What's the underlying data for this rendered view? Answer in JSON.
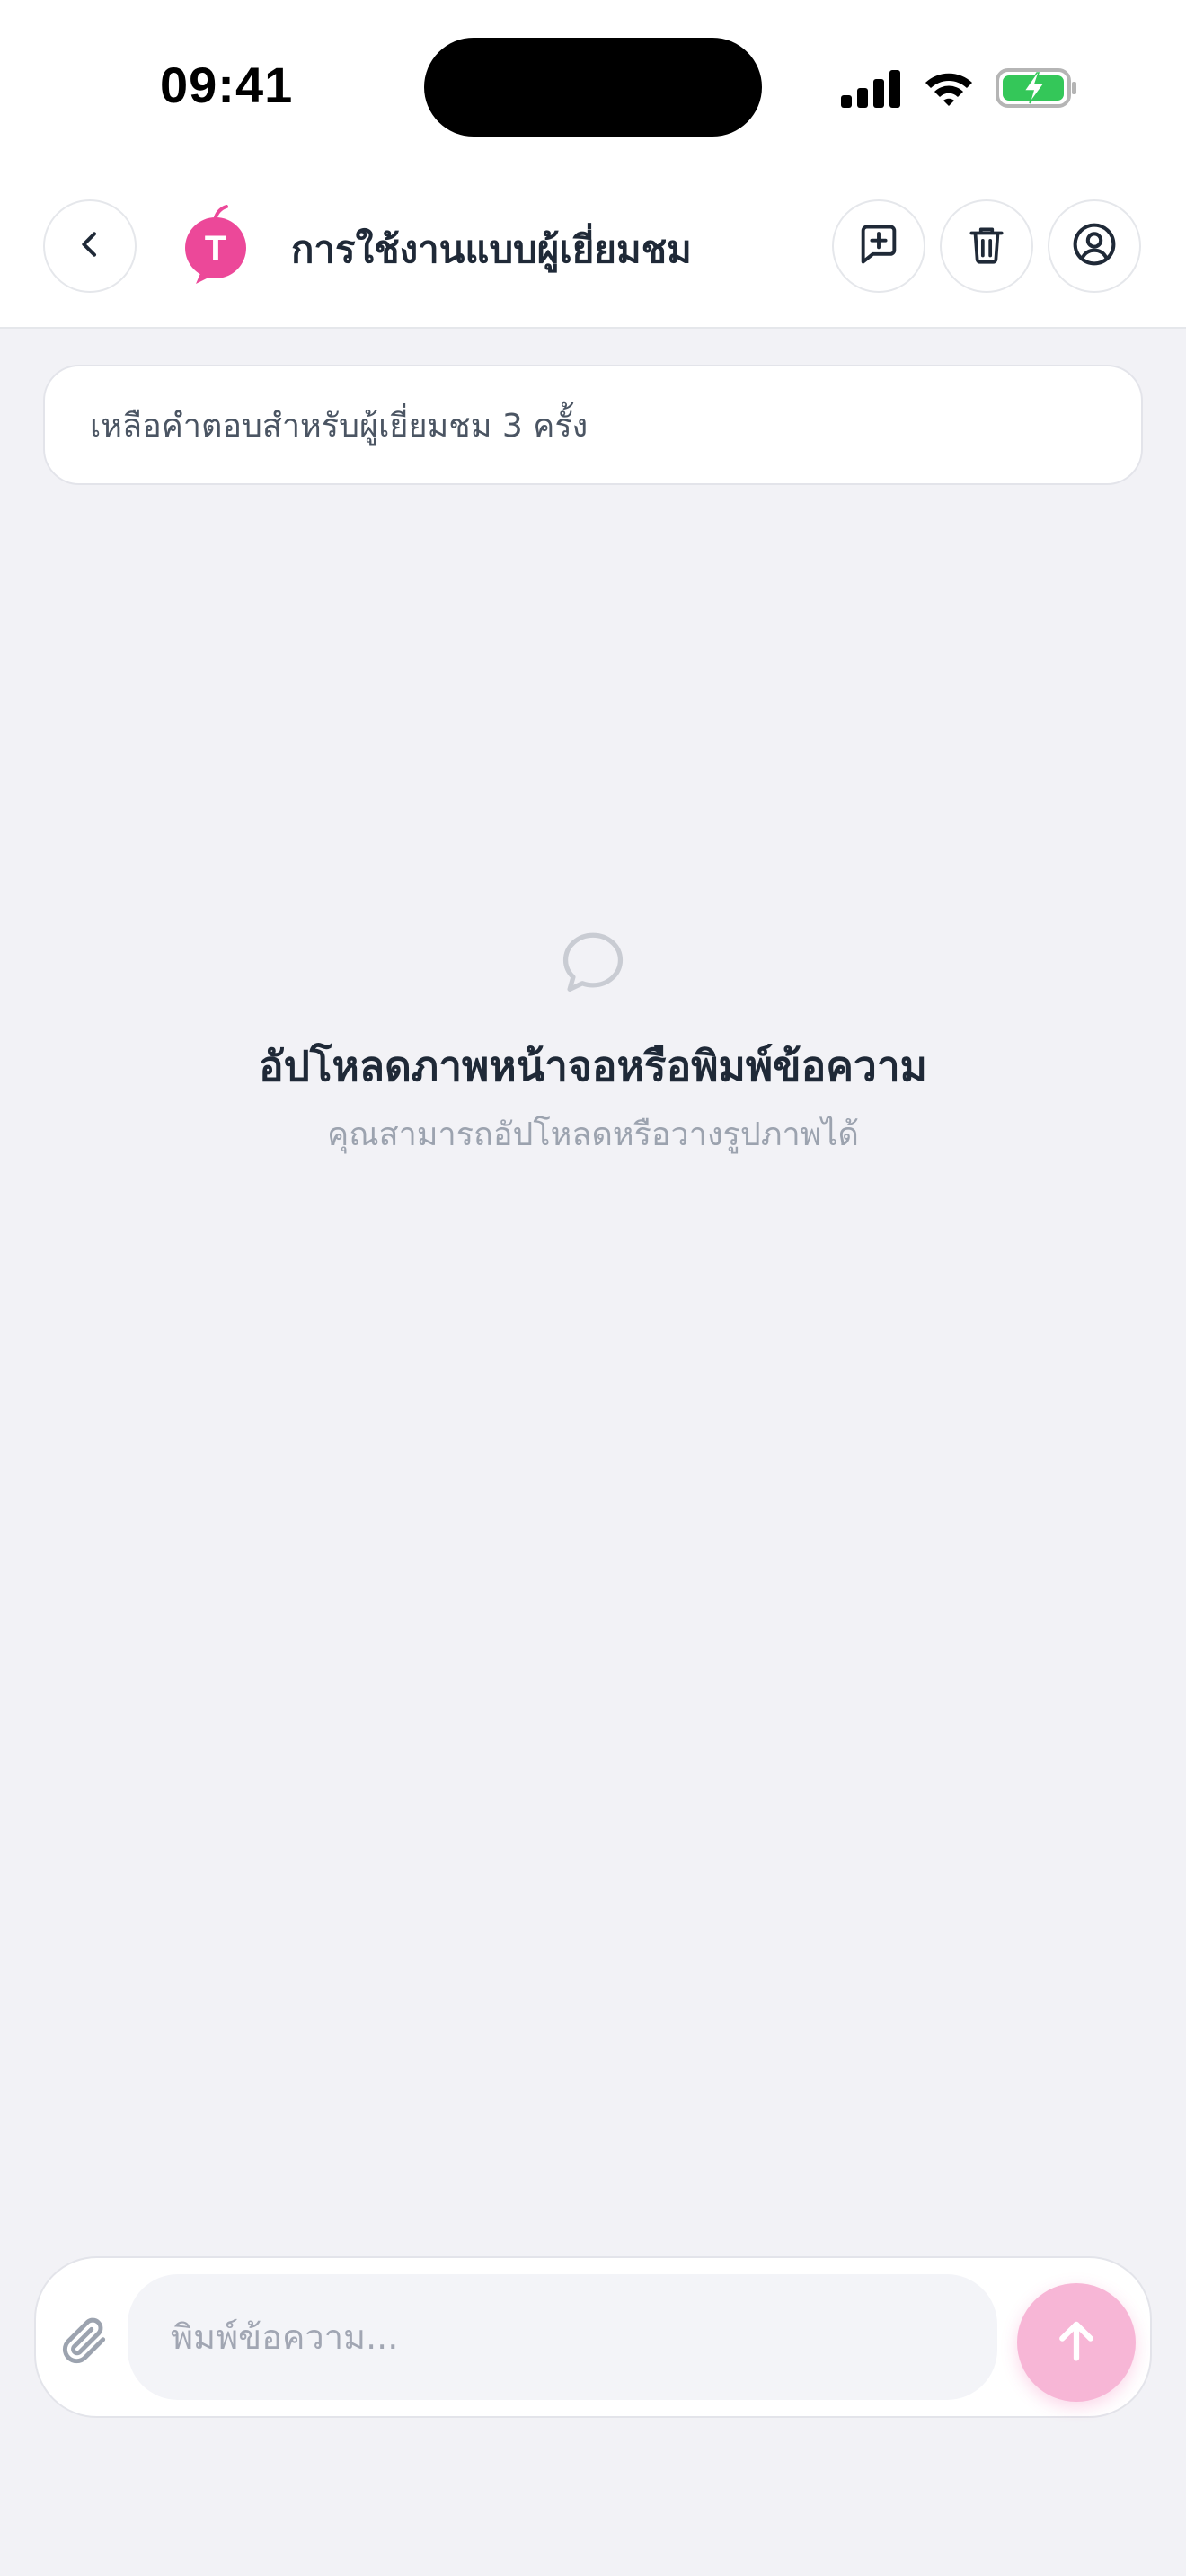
{
  "status_bar": {
    "time": "09:41"
  },
  "header": {
    "title": "การใช้งานแบบผู้เยี่ยมชม",
    "logo_letter": "T",
    "logo_color": "#ec4899",
    "icons": {
      "back": "chevron-left-icon",
      "new_chat": "message-plus-icon",
      "delete": "trash-icon",
      "account": "user-circle-icon"
    }
  },
  "notice": {
    "text": "เหลือคำตอบสำหรับผู้เยี่ยมชม 3 ครั้ง"
  },
  "empty_state": {
    "icon": "chat-bubble-icon",
    "title": "อัปโหลดภาพหน้าจอหรือพิมพ์ข้อความ",
    "subtitle": "คุณสามารถอัปโหลดหรือวางรูปภาพได้"
  },
  "composer": {
    "placeholder": "พิมพ์ข้อความ...",
    "value": "",
    "attach_icon": "paperclip-icon",
    "send_icon": "arrow-up-icon",
    "send_color": "#f7b6d6"
  },
  "colors": {
    "background": "#f2f2f6",
    "accent": "#ec4899",
    "battery": "#34c759"
  }
}
